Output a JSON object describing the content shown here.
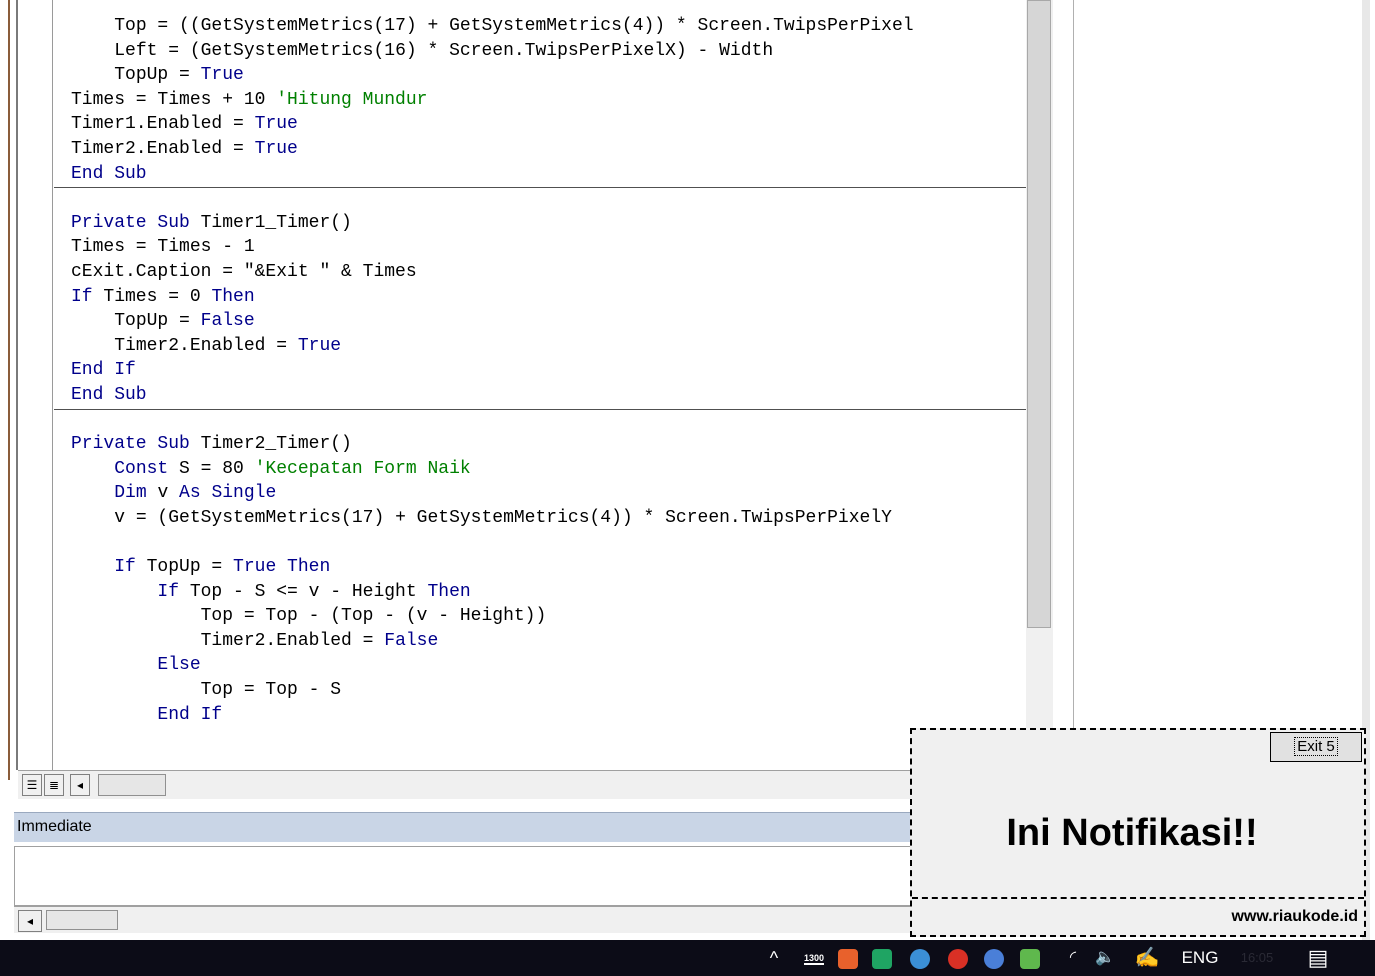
{
  "code": {
    "lines": [
      [
        {
          "t": "Top = ((GetSystemMetrics(17) + GetSystemMetrics(4)) * Screen.TwipsPerPixel",
          "c": ""
        }
      ],
      [
        {
          "t": "Left = (GetSystemMetrics(16) * Screen.TwipsPerPixelX) - Width",
          "c": ""
        }
      ],
      [
        {
          "t": "TopUp = ",
          "c": ""
        },
        {
          "t": "True",
          "c": "kw"
        }
      ],
      [
        {
          "t": "Times = Times + 10 ",
          "c": ""
        },
        {
          "t": "'Hitung Mundur",
          "c": "cm"
        }
      ],
      [
        {
          "t": "Timer1.Enabled = ",
          "c": ""
        },
        {
          "t": "True",
          "c": "kw"
        }
      ],
      [
        {
          "t": "Timer2.Enabled = ",
          "c": ""
        },
        {
          "t": "True",
          "c": "kw"
        }
      ],
      [
        {
          "t": "End Sub",
          "c": "kw"
        }
      ],
      [
        {
          "t": "",
          "c": ""
        }
      ],
      [
        {
          "t": "Private Sub ",
          "c": "kw"
        },
        {
          "t": "Timer1_Timer()",
          "c": ""
        }
      ],
      [
        {
          "t": "Times = Times - 1",
          "c": ""
        }
      ],
      [
        {
          "t": "cExit.Caption = \"&Exit \" & Times",
          "c": ""
        }
      ],
      [
        {
          "t": "If ",
          "c": "kw"
        },
        {
          "t": "Times = 0 ",
          "c": ""
        },
        {
          "t": "Then",
          "c": "kw"
        }
      ],
      [
        {
          "t": "TopUp = ",
          "c": ""
        },
        {
          "t": "False",
          "c": "kw"
        }
      ],
      [
        {
          "t": "Timer2.Enabled = ",
          "c": ""
        },
        {
          "t": "True",
          "c": "kw"
        }
      ],
      [
        {
          "t": "End If",
          "c": "kw"
        }
      ],
      [
        {
          "t": "End Sub",
          "c": "kw"
        }
      ],
      [
        {
          "t": "",
          "c": ""
        }
      ],
      [
        {
          "t": "Private Sub ",
          "c": "kw"
        },
        {
          "t": "Timer2_Timer()",
          "c": ""
        }
      ],
      [
        {
          "t": "Const ",
          "c": "kw"
        },
        {
          "t": "S = 80 ",
          "c": ""
        },
        {
          "t": "'Kecepatan Form Naik",
          "c": "cm"
        }
      ],
      [
        {
          "t": "Dim ",
          "c": "kw"
        },
        {
          "t": "v ",
          "c": ""
        },
        {
          "t": "As Single",
          "c": "kw"
        }
      ],
      [
        {
          "t": "v = (GetSystemMetrics(17) + GetSystemMetrics(4)) * Screen.TwipsPerPixelY",
          "c": ""
        }
      ],
      [
        {
          "t": "",
          "c": ""
        }
      ],
      [
        {
          "t": "If ",
          "c": "kw"
        },
        {
          "t": "TopUp = ",
          "c": ""
        },
        {
          "t": "True Then",
          "c": "kw"
        }
      ],
      [
        {
          "t": "If ",
          "c": "kw"
        },
        {
          "t": "Top - S <= v - Height ",
          "c": ""
        },
        {
          "t": "Then",
          "c": "kw"
        }
      ],
      [
        {
          "t": "Top = Top - (Top - (v - Height))",
          "c": ""
        }
      ],
      [
        {
          "t": "Timer2.Enabled = ",
          "c": ""
        },
        {
          "t": "False",
          "c": "kw"
        }
      ],
      [
        {
          "t": "Else",
          "c": "kw"
        }
      ],
      [
        {
          "t": "Top = Top - S",
          "c": ""
        }
      ],
      [
        {
          "t": "End If",
          "c": "kw"
        }
      ]
    ],
    "indents": [
      1,
      1,
      1,
      0,
      0,
      0,
      0,
      0,
      0,
      0,
      0,
      0,
      1,
      1,
      0,
      0,
      0,
      0,
      1,
      1,
      1,
      0,
      1,
      2,
      3,
      3,
      2,
      3,
      2
    ]
  },
  "immediate": {
    "title": "Immediate"
  },
  "notification": {
    "message": "Ini Notifikasi!!",
    "exit_label": "Exit 5",
    "url": "www.riaukode.id"
  },
  "taskbar": {
    "language": "ENG",
    "badge": "1300",
    "chevron": "^",
    "clock": "16:05"
  },
  "colors": {
    "keyword": "#00008b",
    "comment": "#008000",
    "taskbar": "#0c0c17"
  }
}
